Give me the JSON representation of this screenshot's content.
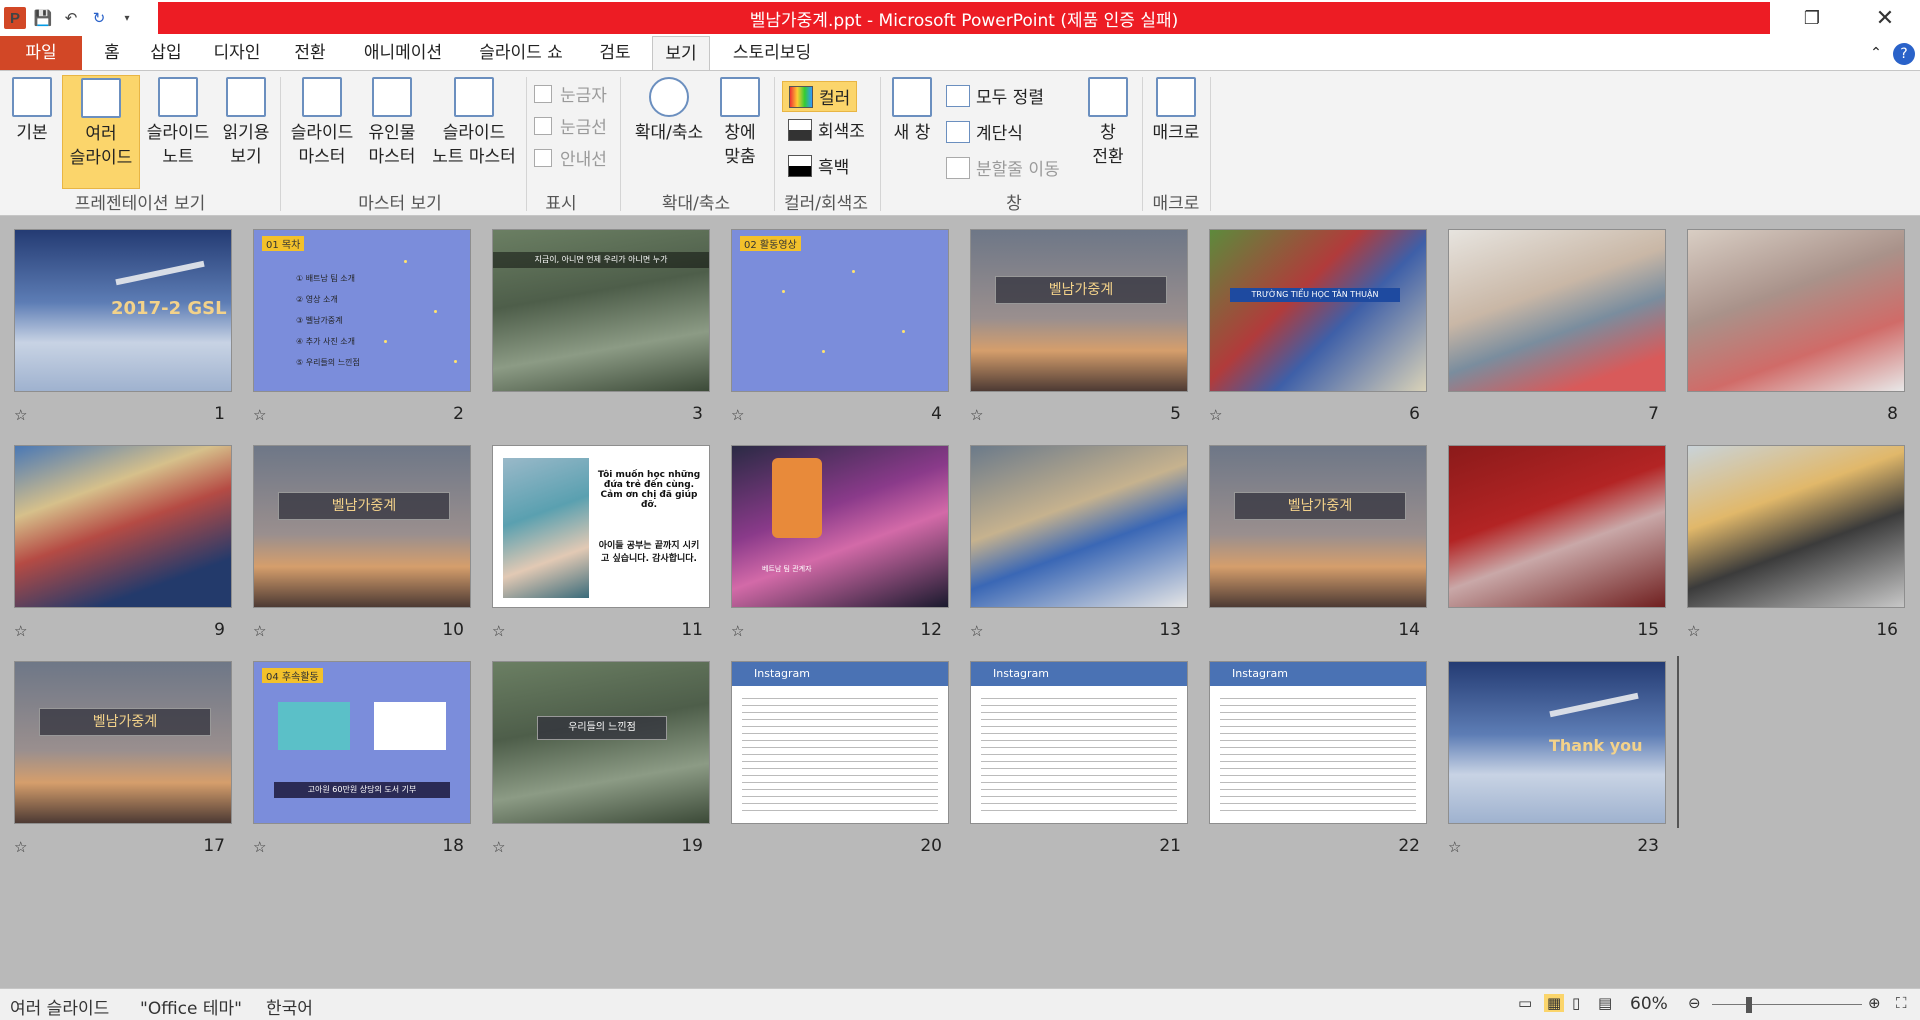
{
  "window": {
    "title": "벨남가중계.ppt - Microsoft PowerPoint (제품 인증 실패)"
  },
  "tabs": [
    "파일",
    "홈",
    "삽입",
    "디자인",
    "전환",
    "애니메이션",
    "슬라이드 쇼",
    "검토",
    "보기",
    "스토리보딩"
  ],
  "ribbon": {
    "basic": "기본",
    "sorter_1": "여러",
    "sorter_2": "슬라이드",
    "notes_1": "슬라이드",
    "notes_2": "노트",
    "reading_1": "읽기용",
    "reading_2": "보기",
    "group_views": "프레젠테이션 보기",
    "slide_master_1": "슬라이드",
    "slide_master_2": "마스터",
    "handout_1": "유인물",
    "handout_2": "마스터",
    "notes_master_1": "슬라이드",
    "notes_master_2": "노트 마스터",
    "group_master": "마스터 보기",
    "ruler": "눈금자",
    "gridlines": "눈금선",
    "guides": "안내선",
    "group_show": "표시",
    "zoom": "확대/축소",
    "fit_1": "창에",
    "fit_2": "맞춤",
    "group_zoom": "확대/축소",
    "color": "컬러",
    "grayscale": "회색조",
    "bw": "흑백",
    "group_color": "컬러/회색조",
    "new_window_1": "새 창",
    "arrange_all": "모두 정렬",
    "cascade": "계단식",
    "move_split": "분할줄 이동",
    "switch_1": "창",
    "switch_2": "전환",
    "group_window": "창",
    "macros": "매크로",
    "group_macros": "매크로"
  },
  "slides": [
    {
      "n": "1",
      "text": "2017-2 GSL"
    },
    {
      "n": "2",
      "tag": "01",
      "text": "목차",
      "items": [
        "배트남 팀 소개",
        "영상 소개",
        "벨남가중계",
        "추가 사진 소개",
        "우리들의 느낀점"
      ]
    },
    {
      "n": "3",
      "text": "지금이, 아니면 언제 우리가 아니면 누가"
    },
    {
      "n": "4",
      "tag": "02",
      "text": "활동영상"
    },
    {
      "n": "5",
      "text": "벨남가중계"
    },
    {
      "n": "6",
      "text": "TRƯỜNG TIỂU HỌC TÂN THUẬN"
    },
    {
      "n": "7",
      "text": ""
    },
    {
      "n": "8",
      "text": ""
    },
    {
      "n": "9",
      "text": ""
    },
    {
      "n": "10",
      "text": "벨남가중계"
    },
    {
      "n": "11",
      "text": "Tôi muốn học những đứa trẻ đến cùng. Cảm ơn chị đã giúp đỡ.",
      "text2": "아이들 공부는 끝까지 시키고 싶습니다. 감사합니다."
    },
    {
      "n": "12",
      "text": "베트남 팀 관계자"
    },
    {
      "n": "13",
      "text": ""
    },
    {
      "n": "14",
      "text": "벨남가중계"
    },
    {
      "n": "15",
      "text": ""
    },
    {
      "n": "16",
      "text": ""
    },
    {
      "n": "17",
      "text": "벨남가중계"
    },
    {
      "n": "18",
      "tag": "04",
      "text": "후속활동",
      "text2": "고아원 60만원 상당의 도서 기부"
    },
    {
      "n": "19",
      "text": "우리들의 느낀점"
    },
    {
      "n": "20",
      "text": "Instagram"
    },
    {
      "n": "21",
      "text": "Instagram"
    },
    {
      "n": "22",
      "text": "Instagram"
    },
    {
      "n": "23",
      "text": "Thank you"
    }
  ],
  "status": {
    "view": "여러 슬라이드",
    "theme": "\"Office 테마\"",
    "lang": "한국어",
    "zoom": "60%"
  }
}
